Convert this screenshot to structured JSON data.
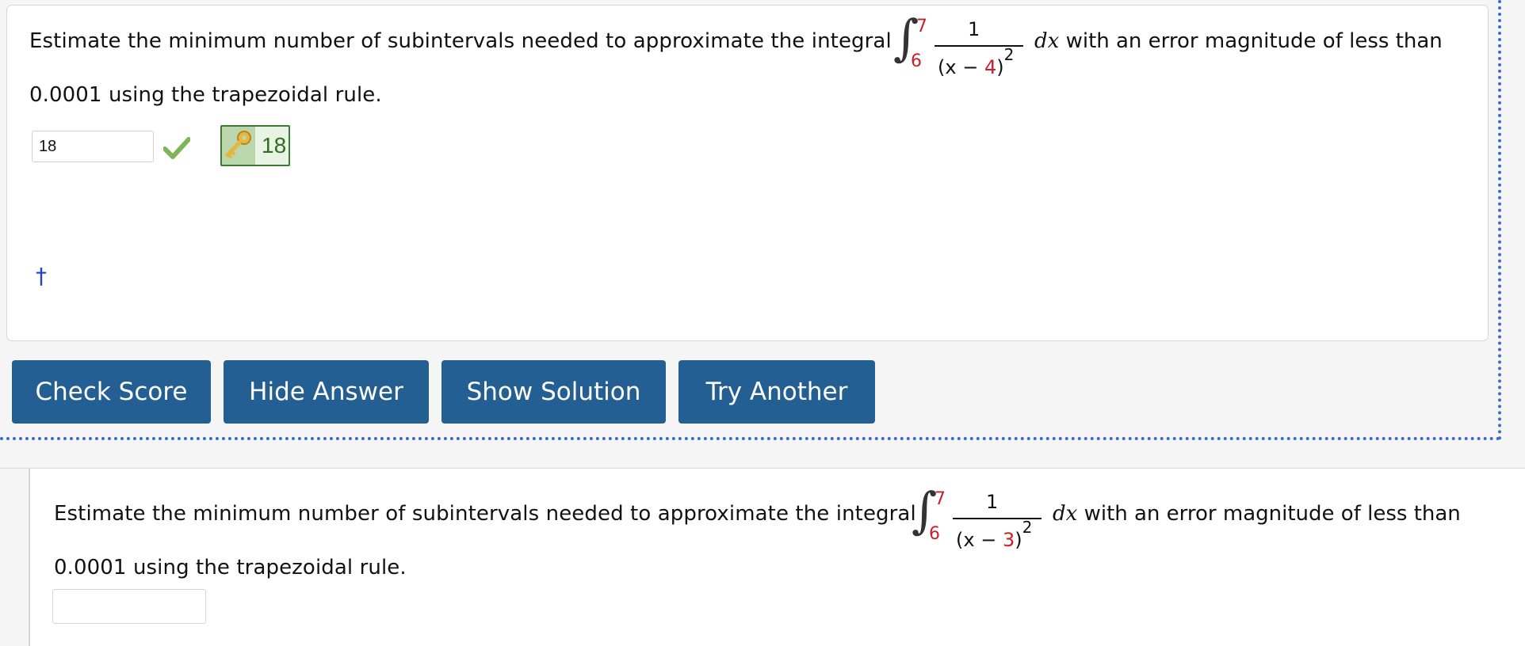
{
  "question1": {
    "text_before": "Estimate the minimum number of subintervals needed to approximate the integral",
    "integral": {
      "symbol": "∫",
      "upper_limit": "7",
      "lower_limit": "6",
      "numerator": "1",
      "den_open": "(x − ",
      "den_value": "4",
      "den_close": ")",
      "den_exponent": "2",
      "differential": "dx"
    },
    "text_after": " with an error magnitude of less than",
    "text_line2": "0.0001 using the trapezoidal rule.",
    "answer_value": "18",
    "correct_answer": "18",
    "dagger": "†"
  },
  "buttons": {
    "check_score": "Check Score",
    "hide_answer": "Hide Answer",
    "show_solution": "Show Solution",
    "try_another": "Try Another"
  },
  "question2": {
    "text_before": "Estimate the minimum number of subintervals needed to approximate the integral",
    "integral": {
      "symbol": "∫",
      "upper_limit": "7",
      "lower_limit": "6",
      "numerator": "1",
      "den_open": "(x − ",
      "den_value": "3",
      "den_close": ")",
      "den_exponent": "2",
      "differential": "dx"
    },
    "text_after": " with an error magnitude of less than",
    "text_line2": "0.0001 using the trapezoidal rule.",
    "answer_value": ""
  },
  "colors": {
    "button_bg": "#245f93",
    "accent_red": "#c8202a",
    "answer_green": "#2e6d22",
    "dagger_blue": "#2145c7"
  },
  "icons": [
    "checkmark-icon",
    "key-icon"
  ]
}
